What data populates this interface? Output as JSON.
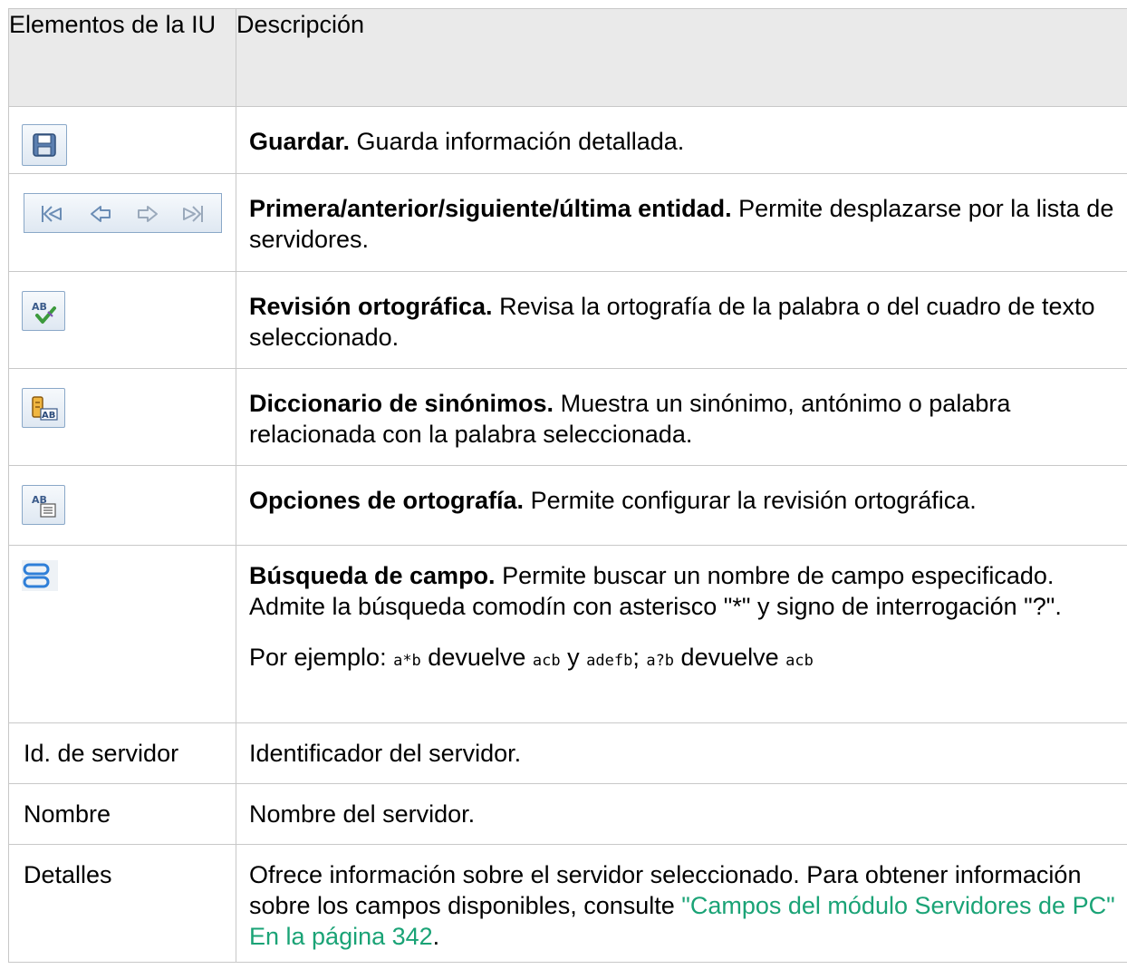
{
  "table": {
    "header": {
      "col1": "Elementos de la IU",
      "col2": "Descripción"
    },
    "rows": [
      {
        "term": "Guardar.",
        "text": " Guarda información detallada."
      },
      {
        "term": "Primera/anterior/siguiente/última entidad.",
        "text": " Permite desplazarse por la lista de servidores."
      },
      {
        "term": "Revisión ortográfica.",
        "text": " Revisa la ortografía de la palabra o del cuadro de texto seleccionado."
      },
      {
        "term": "Diccionario de sinónimos.",
        "text": " Muestra un sinónimo, antónimo o palabra relacionada con la palabra seleccionada."
      },
      {
        "term": "Opciones de ortografía.",
        "text": " Permite configurar la revisión ortográfica."
      },
      {
        "term": "Búsqueda de campo.",
        "text": " Permite buscar un nombre de campo especificado. Admite la búsqueda comodín con asterisco \"*\" y signo de interrogación \"?\".",
        "example": {
          "prefix": "Por ejemplo: ",
          "code1": "a*b",
          "t1": " devuelve ",
          "code2": "acb",
          "t2": " y ",
          "code3": "adefb",
          "t3": "; ",
          "code4": "a?b",
          "t4": " devuelve ",
          "code5": "acb"
        }
      },
      {
        "label": "Id. de servidor",
        "text": "Identificador del servidor."
      },
      {
        "label": "Nombre",
        "text": "Nombre del servidor."
      },
      {
        "label": "Detalles",
        "text": "Ofrece información sobre el servidor seleccionado. Para obtener información sobre los campos disponibles, consulte ",
        "link": "\"Campos del módulo Servidores de PC\" En la página 342",
        "after": "."
      }
    ]
  },
  "icons": {
    "save": "save-icon",
    "first": "first-entity-icon",
    "previous": "previous-entity-icon",
    "next": "next-entity-icon",
    "last": "last-entity-icon",
    "spell": "spell-check-icon",
    "thesaurus": "thesaurus-icon",
    "spell_options": "spelling-options-icon",
    "field_search": "field-search-icon"
  },
  "colors": {
    "link": "#1aa376",
    "header_bg": "#eaeaea",
    "border": "#c8c8c8"
  }
}
